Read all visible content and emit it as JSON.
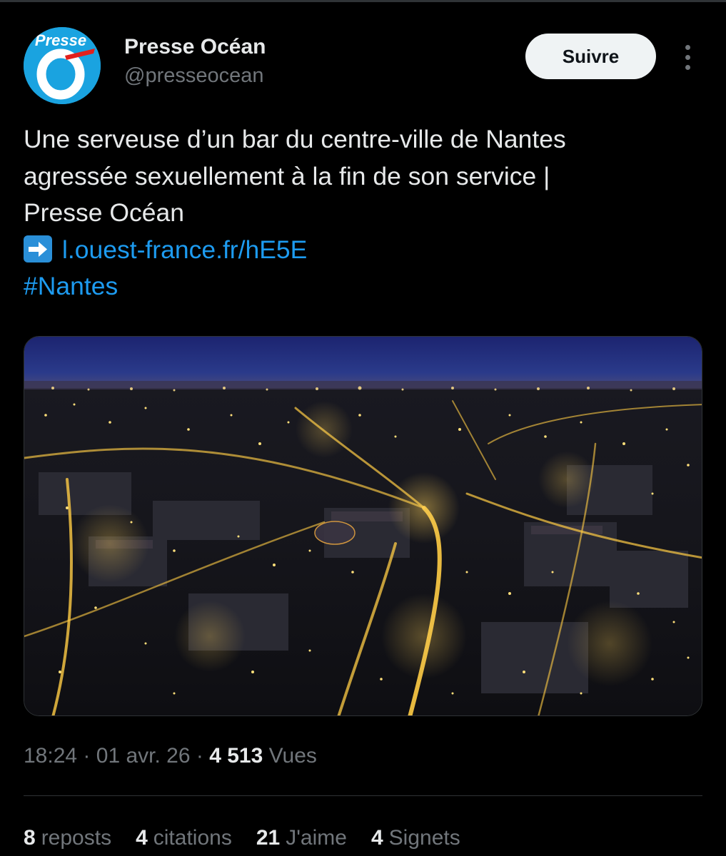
{
  "colors": {
    "background": "#000000",
    "text_primary": "#e7e9ea",
    "text_secondary": "#71767b",
    "link": "#1d9bf0",
    "avatar_blue": "#1aa3e0",
    "follow_button_bg": "#eff3f4"
  },
  "author": {
    "display_name": "Presse Océan",
    "handle": "@presseocean",
    "avatar_logo_text": "Presse",
    "avatar_logo_letter": "O"
  },
  "header": {
    "follow_label": "Suivre",
    "more_icon": "more-vertical-icon"
  },
  "tweet": {
    "text_lines": [
      "Une serveuse d’un bar du centre-ville de Nantes",
      "agressée sexuellement à la fin de son service |",
      "Presse Océan"
    ],
    "arrow_icon": "right-arrow-emoji-icon",
    "link_text": "l.ouest-france.fr/hE5E",
    "hashtag": "#Nantes"
  },
  "media": {
    "type": "photo"
  },
  "meta": {
    "time": "18:24",
    "date": "01 avr. 26",
    "separator": "·",
    "views_count": "4 513",
    "views_label": "Vues"
  },
  "stats": [
    {
      "count": "8",
      "label": "reposts"
    },
    {
      "count": "4",
      "label": "citations"
    },
    {
      "count": "21",
      "label": "J'aime"
    },
    {
      "count": "4",
      "label": "Signets"
    }
  ]
}
